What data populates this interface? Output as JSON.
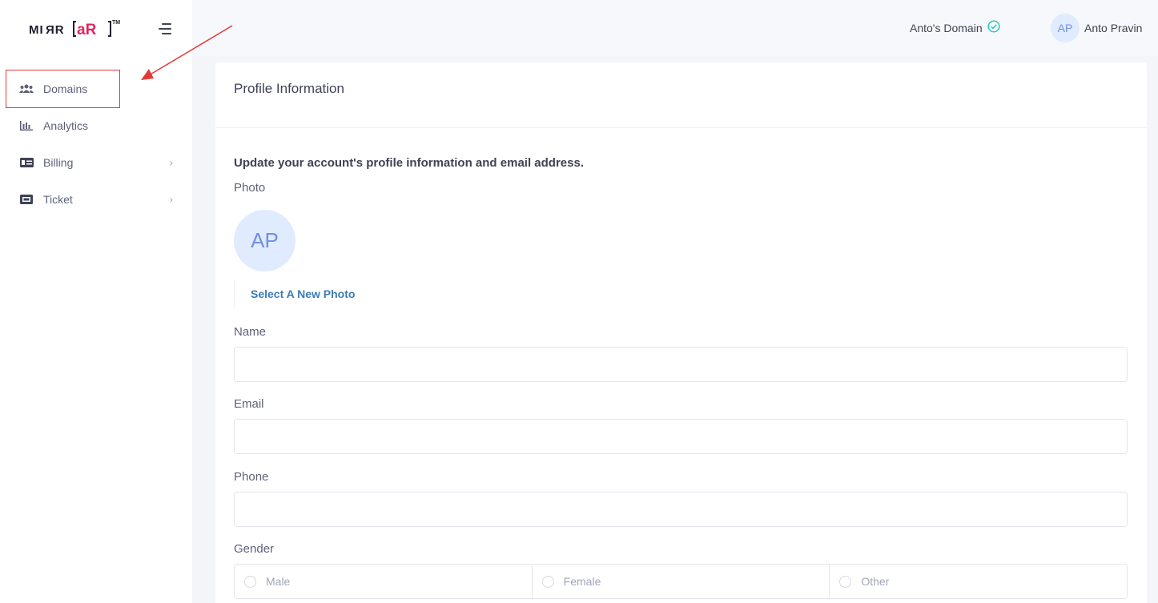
{
  "brand": {
    "logo_text": "MIRR[AR]™",
    "logo_alt": "MirrAR logo"
  },
  "sidebar": {
    "items": [
      {
        "label": "Domains",
        "icon": "users-icon",
        "has_chevron": false,
        "highlighted": true
      },
      {
        "label": "Analytics",
        "icon": "bar-chart-icon",
        "has_chevron": false
      },
      {
        "label": "Billing",
        "icon": "billing-icon",
        "has_chevron": true
      },
      {
        "label": "Ticket",
        "icon": "ticket-icon",
        "has_chevron": true
      }
    ]
  },
  "header": {
    "domain": "Anto's Domain",
    "domain_status": "verified",
    "user_initials": "AP",
    "user_name": "Anto Pravin"
  },
  "card": {
    "title": "Profile Information",
    "description": "Update your account's profile information and email address.",
    "photo_label": "Photo",
    "photo_initials": "AP",
    "select_photo": "Select A New Photo",
    "name_label": "Name",
    "name_value": "",
    "email_label": "Email",
    "email_value": "",
    "phone_label": "Phone",
    "phone_value": "",
    "gender_label": "Gender",
    "gender_options": [
      "Male",
      "Female",
      "Other"
    ]
  },
  "colors": {
    "accent": "#3d7bb6",
    "avatar_bg": "#e1ebff",
    "avatar_text": "#6f8fe8",
    "annotation": "#e53935",
    "verified": "#1bc5bd"
  }
}
